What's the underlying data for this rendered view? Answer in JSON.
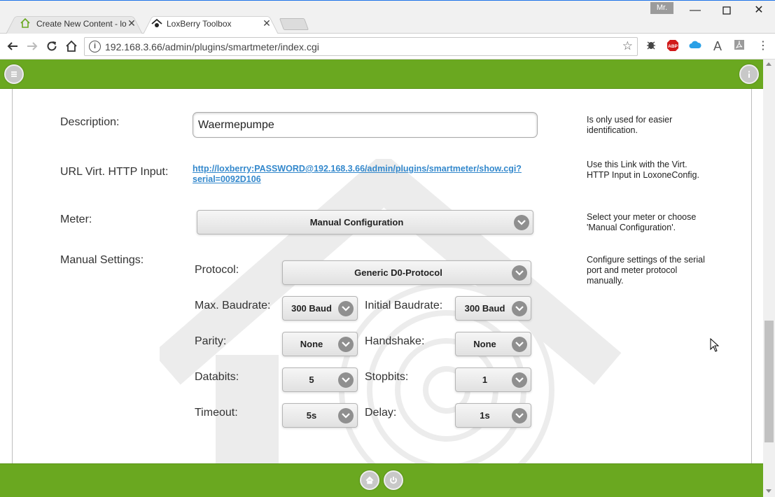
{
  "browser": {
    "tabs": [
      {
        "title": "Create New Content - lo",
        "icon": "loxberry-house-icon",
        "active": false
      },
      {
        "title": "LoxBerry Toolbox",
        "icon": "loxberry-logo-icon",
        "active": true
      }
    ],
    "user_badge": "Mr.",
    "address": "192.168.3.66/admin/plugins/smartmeter/index.cgi"
  },
  "form": {
    "description": {
      "label": "Description:",
      "value": "Waermepumpe",
      "help": "Is only used for easier identification."
    },
    "url": {
      "label": "URL Virt. HTTP Input:",
      "link_line1": "http://loxberry:PASSWORD@192.168.3.66/admin/plugins/smartmeter/show.cgi?",
      "link_line2": "serial=0092D106",
      "help": "Use this Link with the Virt. HTTP Input in LoxoneConfig."
    },
    "meter": {
      "label": "Meter:",
      "value": "Manual Configuration",
      "help": "Select your meter or choose 'Manual Configuration'."
    },
    "manual": {
      "label": "Manual Settings:",
      "help": "Configure settings of the serial port and meter protocol manually.",
      "protocol": {
        "label": "Protocol:",
        "value": "Generic D0-Protocol"
      },
      "max_baudrate": {
        "label": "Max. Baudrate:",
        "value": "300 Baud"
      },
      "initial_baudrate": {
        "label": "Initial Baudrate:",
        "value": "300 Baud"
      },
      "parity": {
        "label": "Parity:",
        "value": "None"
      },
      "handshake": {
        "label": "Handshake:",
        "value": "None"
      },
      "databits": {
        "label": "Databits:",
        "value": "5"
      },
      "stopbits": {
        "label": "Stopbits:",
        "value": "1"
      },
      "timeout": {
        "label": "Timeout:",
        "value": "5s"
      },
      "delay": {
        "label": "Delay:",
        "value": "1s"
      }
    }
  },
  "colors": {
    "header_green": "#6aa820",
    "link_blue": "#3388cc"
  }
}
